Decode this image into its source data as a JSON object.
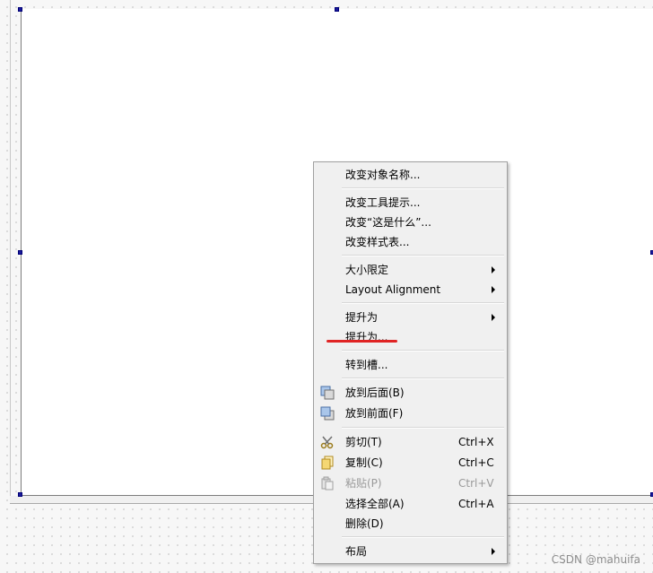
{
  "context_menu": {
    "rename": "改变对象名称...",
    "change_tooltip": "改变工具提示...",
    "change_whatsthis": "改变“这是什么”...",
    "change_stylesheet": "改变样式表...",
    "size_constraints": "大小限定",
    "layout_alignment": "Layout Alignment",
    "promote_to_submenu": "提升为",
    "promote_to_dialog": "提升为...",
    "go_to_slot": "转到槽...",
    "send_to_back": "放到后面(B)",
    "bring_to_front": "放到前面(F)",
    "cut": "剪切(T)",
    "cut_shortcut": "Ctrl+X",
    "copy": "复制(C)",
    "copy_shortcut": "Ctrl+C",
    "paste": "粘贴(P)",
    "paste_shortcut": "Ctrl+V",
    "select_all": "选择全部(A)",
    "select_all_shortcut": "Ctrl+A",
    "delete": "删除(D)",
    "layout": "布局"
  },
  "watermark": "CSDN @mahuifa",
  "colors": {
    "annotation_underline": "#e02424",
    "handle": "#1a1a9a",
    "menu_background": "#f0f0f0"
  }
}
